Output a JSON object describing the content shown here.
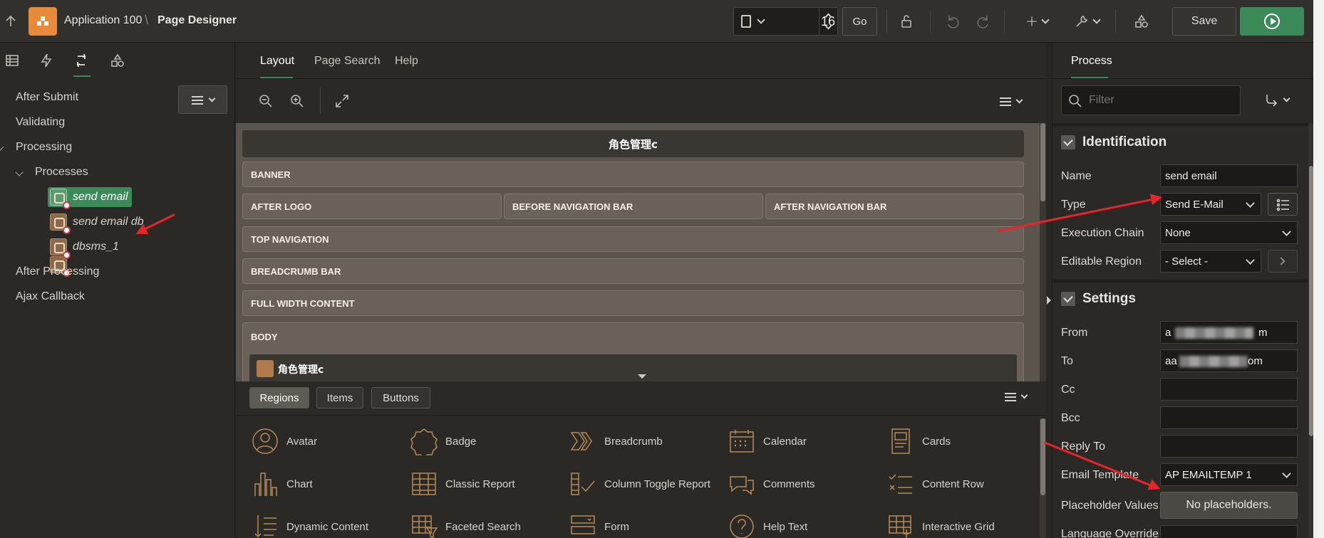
{
  "topbar": {
    "app_title": "Application 100",
    "page_title": "Page Designer",
    "page_number": "16",
    "go_label": "Go",
    "save_label": "Save"
  },
  "left": {
    "tree": {
      "after_submit": "After Submit",
      "validating": "Validating",
      "processing": "Processing",
      "processes": "Processes",
      "items": [
        "send email",
        "send email db",
        "dbsms_1"
      ],
      "after_processing": "After Processing",
      "ajax_callback": "Ajax Callback"
    }
  },
  "center": {
    "tabs": [
      "Layout",
      "Page Search",
      "Help"
    ],
    "page_header": "角色管理c",
    "regions": {
      "banner": "BANNER",
      "after_logo": "AFTER LOGO",
      "before_nav": "BEFORE NAVIGATION BAR",
      "after_nav": "AFTER NAVIGATION BAR",
      "top_nav": "TOP NAVIGATION",
      "breadcrumb": "BREADCRUMB BAR",
      "full_width": "FULL WIDTH CONTENT",
      "body": "BODY",
      "body_region": "角色管理c"
    },
    "gallery_tabs": [
      "Regions",
      "Items",
      "Buttons"
    ],
    "palette": [
      "Avatar",
      "Badge",
      "Breadcrumb",
      "Calendar",
      "Cards",
      "Chart",
      "Classic Report",
      "Column Toggle Report",
      "Comments",
      "Content Row",
      "Dynamic Content",
      "Faceted Search",
      "Form",
      "Help Text",
      "Interactive Grid"
    ]
  },
  "right": {
    "tab": "Process",
    "filter_placeholder": "Filter",
    "identification": {
      "title": "Identification",
      "name_label": "Name",
      "name_value": "send email",
      "type_label": "Type",
      "type_value": "Send E-Mail",
      "exec_chain_label": "Execution Chain",
      "exec_chain_value": "None",
      "editable_region_label": "Editable Region",
      "editable_region_value": "- Select -"
    },
    "settings": {
      "title": "Settings",
      "from_label": "From",
      "from_value_start": "a",
      "from_value_end": "m",
      "to_label": "To",
      "to_value_start": "aa",
      "to_value_end": "om",
      "cc_label": "Cc",
      "bcc_label": "Bcc",
      "reply_to_label": "Reply To",
      "email_template_label": "Email Template",
      "email_template_value": "AP EMAILTEMP 1",
      "placeholder_values_label": "Placeholder Values",
      "placeholder_values_button": "No placeholders.",
      "language_override_label": "Language Override"
    }
  },
  "colors": {
    "accent_green": "#3c8a5a",
    "logo_orange": "#e88a3c",
    "annotation_red": "#e6252a"
  }
}
